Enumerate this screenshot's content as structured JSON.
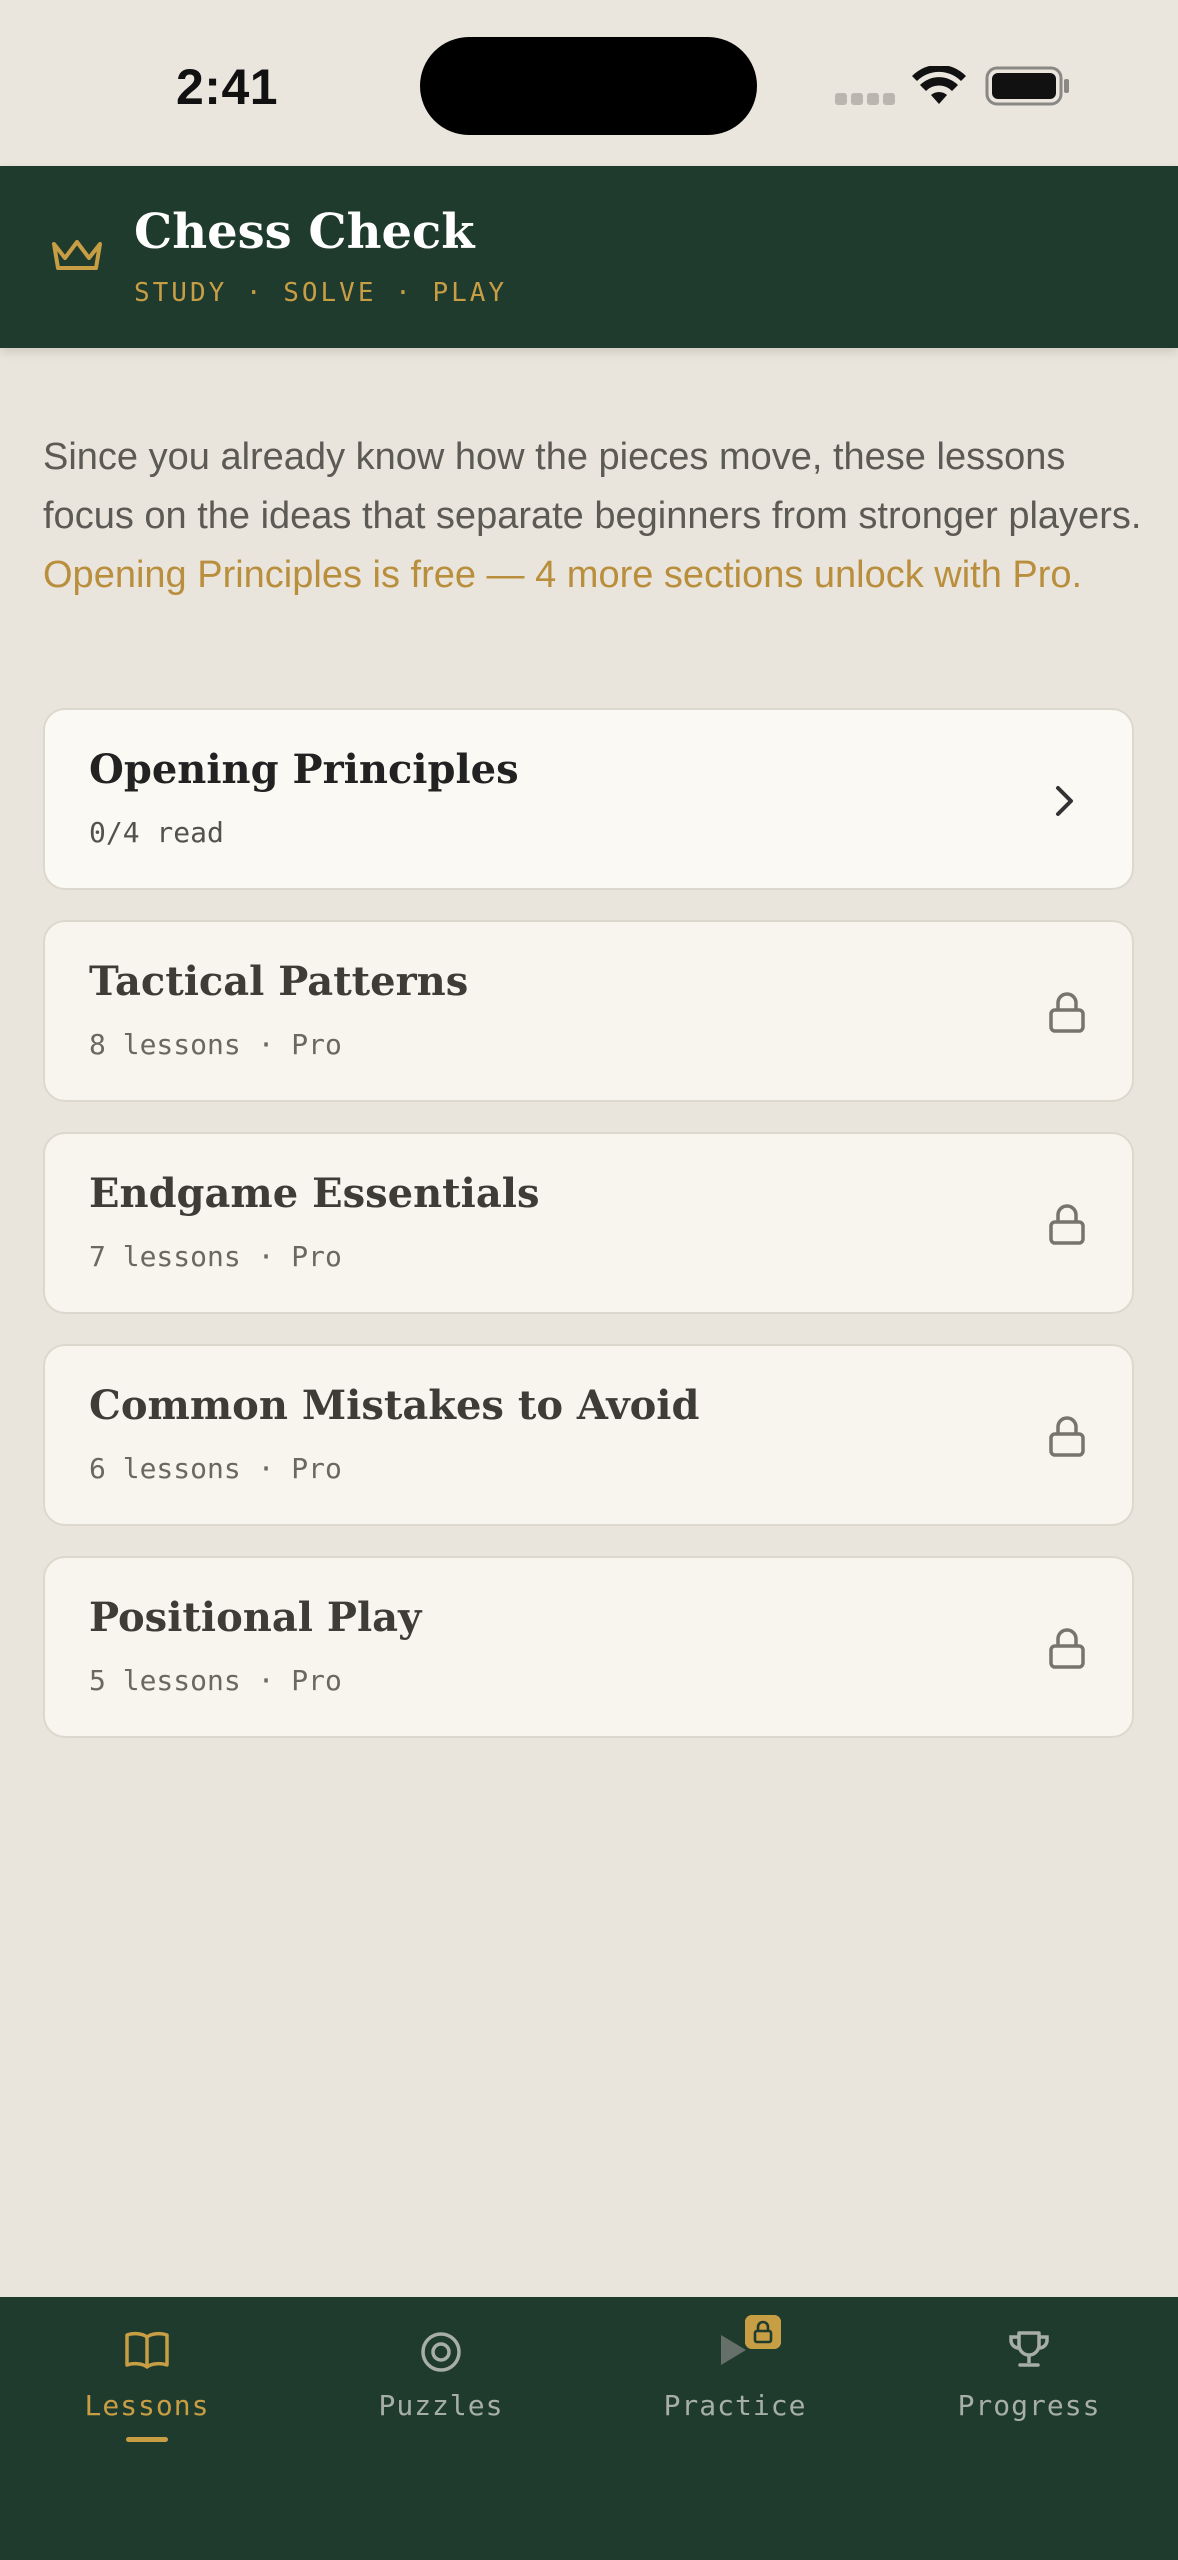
{
  "status_bar": {
    "time": "2:41"
  },
  "header": {
    "title": "Chess Check",
    "subtitle": "STUDY · SOLVE · PLAY",
    "icon": "crown-icon"
  },
  "intro": {
    "text": "Since you already know how the pieces move, these lessons focus on the ideas that separate beginners from stronger players. ",
    "highlight": "Opening Principles is free — 4 more sections unlock with Pro."
  },
  "sections": [
    {
      "title": "Opening Principles",
      "meta": "0/4 read",
      "locked": false,
      "icon": "chevron-right-icon"
    },
    {
      "title": "Tactical Patterns",
      "meta": "8 lessons · Pro",
      "locked": true,
      "icon": "lock-icon"
    },
    {
      "title": "Endgame Essentials",
      "meta": "7 lessons · Pro",
      "locked": true,
      "icon": "lock-icon"
    },
    {
      "title": "Common Mistakes to Avoid",
      "meta": "6 lessons · Pro",
      "locked": true,
      "icon": "lock-icon"
    },
    {
      "title": "Positional Play",
      "meta": "5 lessons · Pro",
      "locked": true,
      "icon": "lock-icon"
    }
  ],
  "bottom_nav": {
    "items": [
      {
        "label": "Lessons",
        "icon": "book-icon",
        "active": true
      },
      {
        "label": "Puzzles",
        "icon": "target-icon",
        "active": false
      },
      {
        "label": "Practice",
        "icon": "play-icon",
        "active": false,
        "badge": "lock-icon"
      },
      {
        "label": "Progress",
        "icon": "trophy-icon",
        "active": false
      }
    ]
  },
  "colors": {
    "header_bg": "#1F3B2E",
    "accent": "#C89E45",
    "page_bg": "#E9E5DC",
    "card_bg": "#F8F5EE"
  }
}
